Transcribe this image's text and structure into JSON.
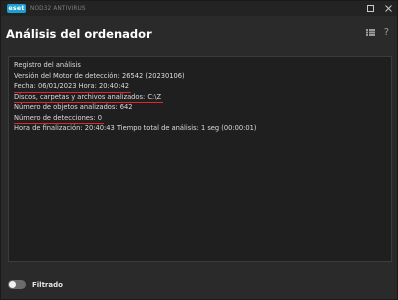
{
  "titlebar": {
    "logo_text": "eset",
    "product_name": "NOD32 ANTIVIRUS",
    "minimize_icon": "square-icon",
    "close_icon": "close-icon"
  },
  "header": {
    "title": "Análisis del ordenador",
    "icons": [
      "grid-menu-icon",
      "help-icon"
    ],
    "help_glyph": "?"
  },
  "log": {
    "lines": [
      "Registro del análisis",
      "Versión del Motor de detección: 26542 (20230106)",
      "Fecha: 06/01/2023  Hora: 20:40:42",
      "Discos, carpetas y archivos analizados: C:\\Z",
      "Número de objetos analizados: 642",
      "Número de detecciones: 0",
      "Hora de finalización: 20:40:43  Tiempo total de análisis: 1 seg (00:00:01)"
    ]
  },
  "footer": {
    "filter_label": "Filtrado",
    "filter_on": false
  },
  "colors": {
    "accent": "#1c9fd1",
    "highlight_underline": "#e0262b"
  }
}
